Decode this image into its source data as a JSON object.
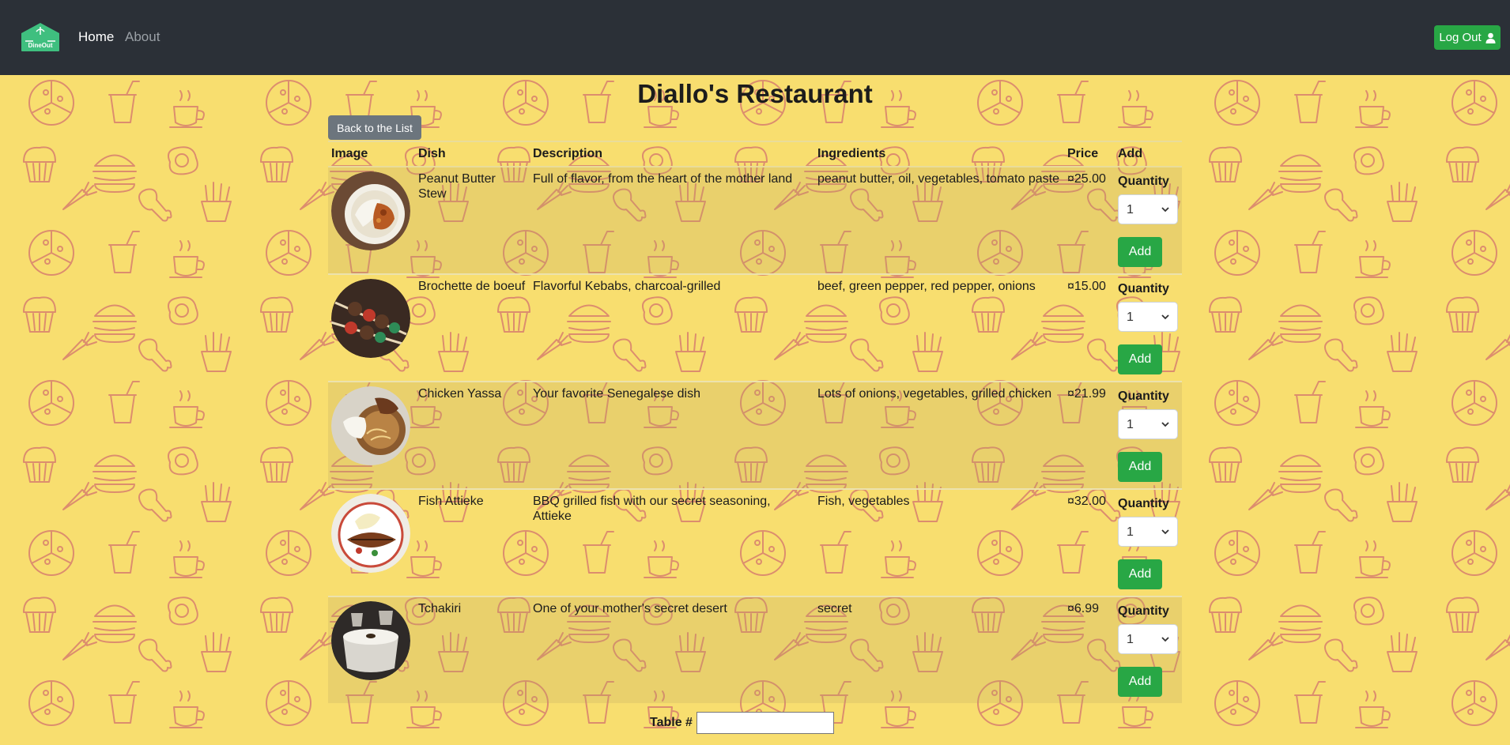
{
  "nav": {
    "brand_text": "DineOut",
    "home_label": "Home",
    "about_label": "About",
    "logout_label": "Log Out",
    "logout_icon": "user-icon"
  },
  "page": {
    "title": "Diallo's Restaurant",
    "back_label": "Back to the List"
  },
  "table": {
    "headers": [
      "Image",
      "Dish",
      "Description",
      "Ingredients",
      "Price",
      "Add"
    ],
    "quantity_label": "Quantity",
    "add_label": "Add",
    "rows": [
      {
        "dish": "Peanut Butter Stew",
        "description": "Full of flavor, from the heart of the mother land",
        "ingredients": "peanut butter, oil, vegetables, tomato paste",
        "price": "¤25.00",
        "quantity": "1"
      },
      {
        "dish": "Brochette de boeuf",
        "description": "Flavorful Kebabs, charcoal-grilled",
        "ingredients": "beef, green pepper, red pepper, onions",
        "price": "¤15.00",
        "quantity": "1"
      },
      {
        "dish": "Chicken Yassa",
        "description": "Your favorite Senegalese dish",
        "ingredients": "Lots of onions, vegetables, grilled chicken",
        "price": "¤21.99",
        "quantity": "1"
      },
      {
        "dish": "Fish Attieke",
        "description": "BBQ grilled fish with our secret seasoning, Attieke",
        "ingredients": "Fish, vegetables",
        "price": "¤32.00",
        "quantity": "1"
      },
      {
        "dish": "Tchakiri",
        "description": "One of your mother's secret desert",
        "ingredients": "secret",
        "price": "¤6.99",
        "quantity": "1"
      }
    ]
  },
  "footer": {
    "table_label": "Table #",
    "table_value": ""
  },
  "colors": {
    "navbar": "#2b3037",
    "background": "#f8de6f",
    "pattern": "#d97c6a",
    "success": "#28a745",
    "secondary": "#6c757d"
  }
}
